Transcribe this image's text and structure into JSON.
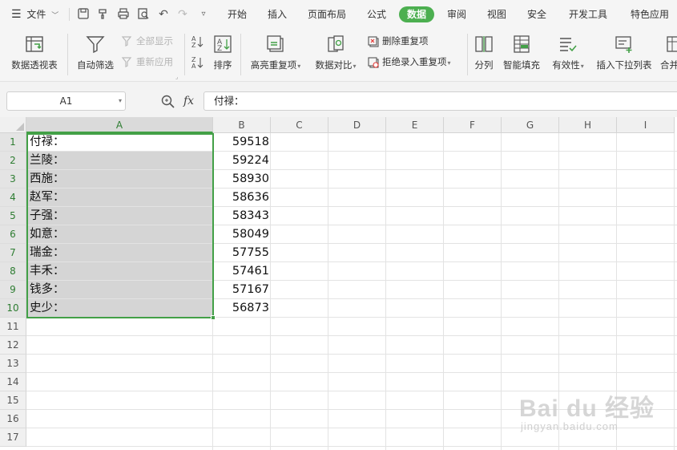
{
  "menu": {
    "file_label": "文件",
    "tabs": [
      "开始",
      "插入",
      "页面布局",
      "公式",
      "数据",
      "审阅",
      "视图",
      "安全",
      "开发工具",
      "特色应用"
    ],
    "active_tab": "数据"
  },
  "ribbon": {
    "pivot_table": "数据透视表",
    "auto_filter": "自动筛选",
    "show_all": "全部显示",
    "reapply": "重新应用",
    "sort": "排序",
    "highlight_duplicates": "高亮重复项",
    "data_compare": "数据对比",
    "delete_duplicates": "删除重复项",
    "reject_duplicates": "拒绝录入重复项",
    "text_to_columns": "分列",
    "smart_fill": "智能填充",
    "validity": "有效性",
    "insert_dropdown": "插入下拉列表",
    "merge_calc": "合并"
  },
  "formula_bar": {
    "cell_ref": "A1",
    "fx": "fx",
    "formula": "付禄："
  },
  "grid": {
    "columns": [
      "A",
      "B",
      "C",
      "D",
      "E",
      "F",
      "G",
      "H",
      "I"
    ],
    "selected_column": "A",
    "rows": [
      "1",
      "2",
      "3",
      "4",
      "5",
      "6",
      "7",
      "8",
      "9",
      "10",
      "11",
      "12",
      "13",
      "14",
      "15",
      "16",
      "17"
    ],
    "data": [
      {
        "a": "付禄：",
        "b": "59518"
      },
      {
        "a": "兰陵：",
        "b": "59224"
      },
      {
        "a": "西施：",
        "b": "58930"
      },
      {
        "a": "赵军：",
        "b": "58636"
      },
      {
        "a": "子强：",
        "b": "58343"
      },
      {
        "a": "如意：",
        "b": "58049"
      },
      {
        "a": "瑞金：",
        "b": "57755"
      },
      {
        "a": "丰禾：",
        "b": "57461"
      },
      {
        "a": "钱多：",
        "b": "57167"
      },
      {
        "a": "史少：",
        "b": "56873"
      }
    ]
  },
  "watermark": {
    "brand": "Bai du 经验",
    "url": "jingyan.baidu.com"
  },
  "colors": {
    "accent": "#4caf50",
    "selection_border": "#43a047",
    "selection_fill": "#d5d5d5"
  }
}
